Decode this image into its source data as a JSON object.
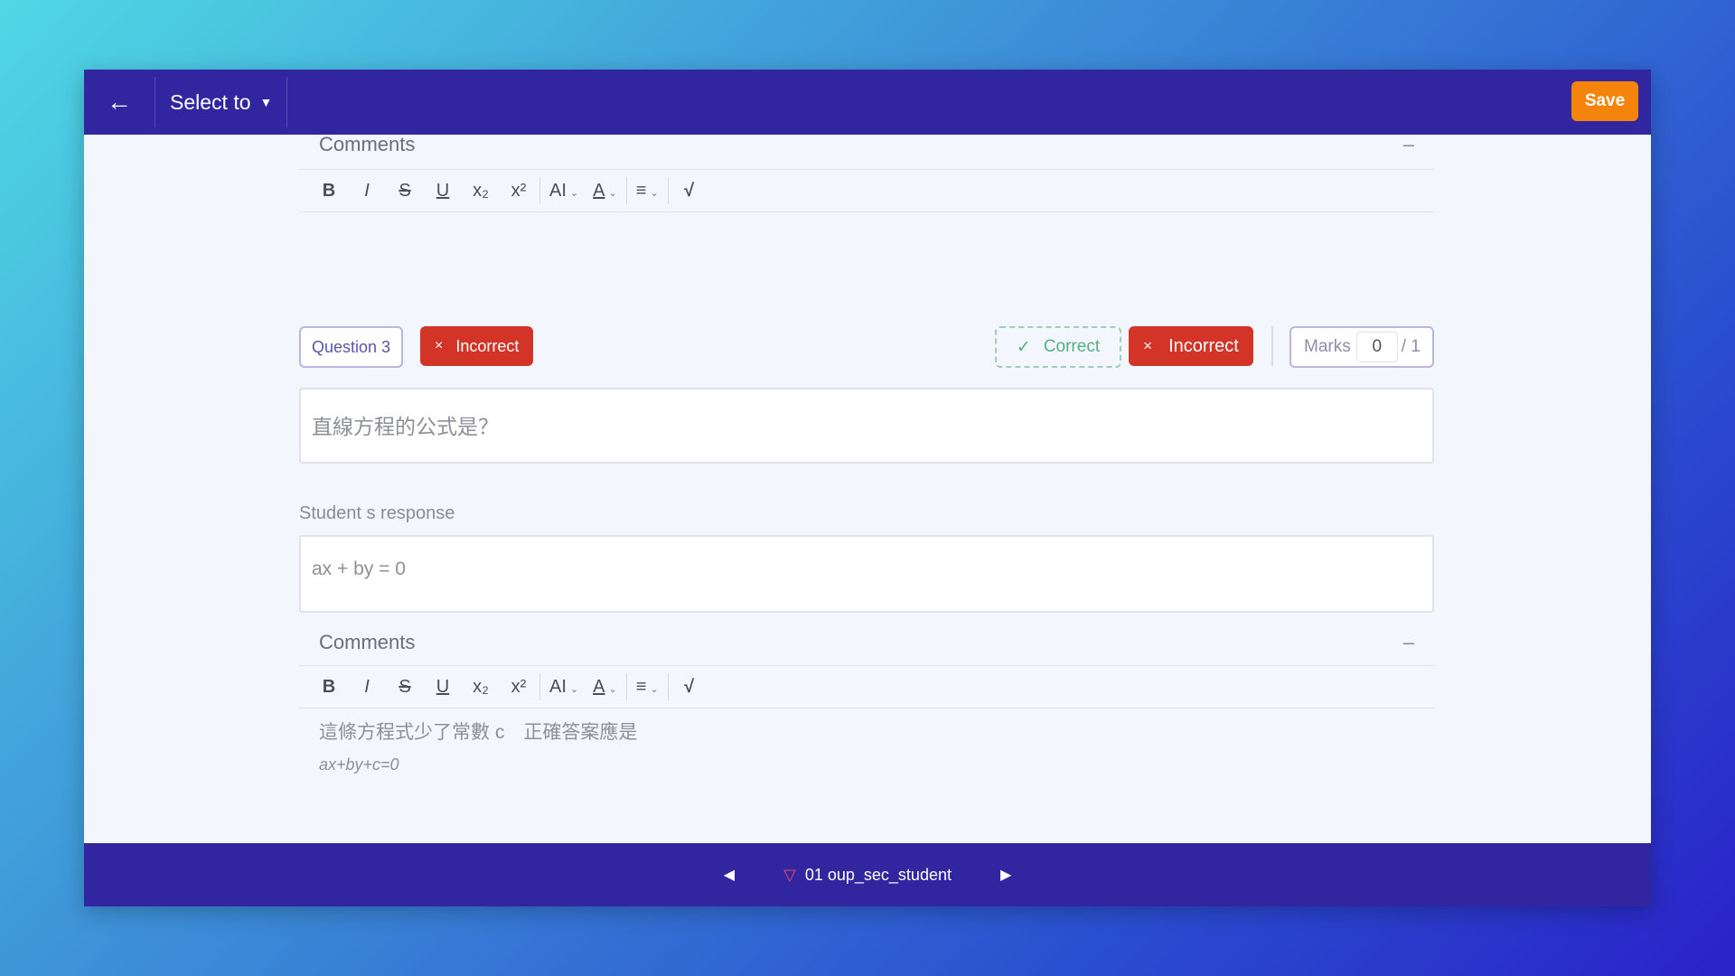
{
  "topbar": {
    "back_icon": "←",
    "select_label": "Select to",
    "select_caret": "▼",
    "save_label": "Save"
  },
  "comments_top": {
    "title": "Comments",
    "collapse_symbol": "–"
  },
  "toolbar": {
    "bold": "B",
    "italic": "I",
    "strike": "S",
    "underline": "U",
    "subscript": "x₂",
    "superscript": "x²",
    "font_size": "AI",
    "font_color": "A",
    "align": "≡",
    "formula": "√",
    "caret": "⌄"
  },
  "question": {
    "badge": "Question 3",
    "status_label": "Incorrect",
    "status_icon": "×",
    "correct_label": "Correct",
    "correct_icon": "✓",
    "incorrect_label": "Incorrect",
    "incorrect_icon": "×",
    "marks_label": "Marks",
    "marks_value": "0",
    "marks_total": "/ 1",
    "text": "直線方程的公式是？"
  },
  "response": {
    "label": "Student s response",
    "text": "ax + by = 0"
  },
  "comments_bottom": {
    "title": "Comments",
    "collapse_symbol": "–",
    "line1": "這條方程式少了常數 c　正確答案應是",
    "line2": "ax+by+c=0"
  },
  "bottombar": {
    "prev_icon": "◀",
    "next_icon": "▶",
    "filter_icon": "▽",
    "student_name": "01 oup_sec_student"
  },
  "colors": {
    "topbar": "#3226a0",
    "save": "#f5840d",
    "incorrect": "#d33428",
    "correct": "#53b07e"
  }
}
